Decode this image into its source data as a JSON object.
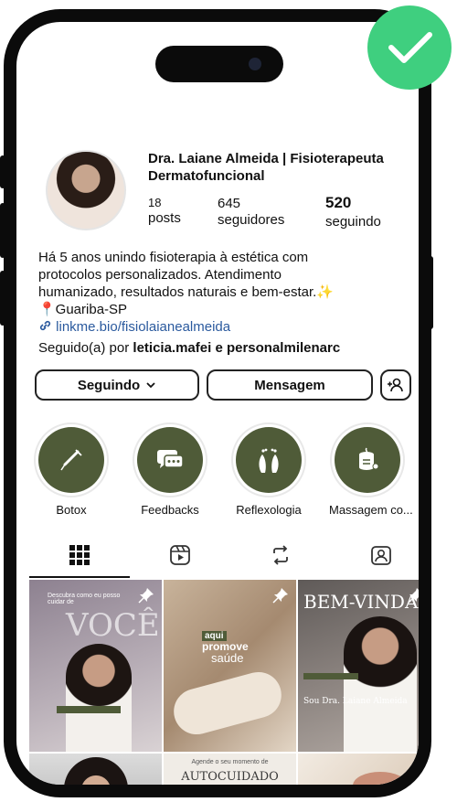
{
  "profile": {
    "name": "Dra. Laiane Almeida | Fisioterapeuta Dermatofuncional",
    "posts_count": "18",
    "posts_label": "posts",
    "followers_count": "645",
    "followers_label": "seguidores",
    "following_count": "520",
    "following_label": "seguindo"
  },
  "bio": {
    "line1": "Há 5 anos unindo fisioterapia à estética com",
    "line2": "protocolos personalizados. Atendimento",
    "line3": "humanizado, resultados naturais e bem-estar.✨",
    "line4": "📍Guariba-SP",
    "link": "linkme.bio/fisiolaianealmeida",
    "followed_by_prefix": "Seguido(a) por ",
    "followed_by_names": "leticia.mafei e personalmilenarc"
  },
  "buttons": {
    "following": "Seguindo",
    "message": "Mensagem"
  },
  "highlights": [
    {
      "label": "Botox",
      "icon": "syringe-icon"
    },
    {
      "label": "Feedbacks",
      "icon": "chat-bubbles-icon"
    },
    {
      "label": "Reflexologia",
      "icon": "feet-icon"
    },
    {
      "label": "Massagem co...",
      "icon": "candle-icon"
    }
  ],
  "tabs": [
    "grid-icon",
    "reels-icon",
    "reposts-icon",
    "tagged-icon"
  ],
  "posts": {
    "p1_small": "Descubra como eu posso cuidar de",
    "p1_big": "VOCÊ!",
    "p2_a": "aqui",
    "p2_b": "promove",
    "p2_c": "saúde",
    "p3_big": "BEM-VINDA",
    "p3_sub": "Sou Dra. Laiane Almeida",
    "p5_small": "Agende o seu momento de",
    "p5_big": "AUTOCUIDADO"
  },
  "colors": {
    "accent_green": "#3fcf7f",
    "highlight_olive": "#4f5b38",
    "link_blue": "#2b5a9e"
  }
}
